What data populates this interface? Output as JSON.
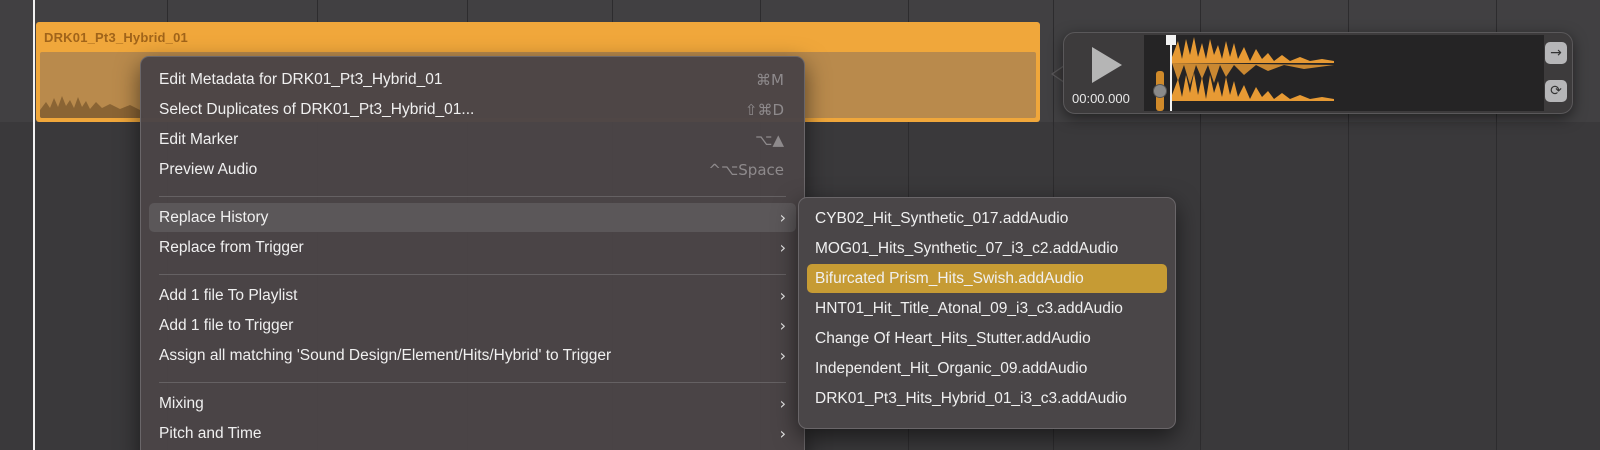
{
  "clip": {
    "title": "DRK01_Pt3_Hybrid_01",
    "color": "#f0a73b"
  },
  "preview": {
    "time": "00:00.000",
    "play_icon": "play-icon",
    "goto_icon": "arrow-right-icon",
    "loop_icon": "loop-icon",
    "goto_glyph": "→",
    "loop_glyph": "⟳"
  },
  "context_menu": {
    "items": [
      {
        "label": "Edit Metadata for DRK01_Pt3_Hybrid_01",
        "shortcut": "⌘M"
      },
      {
        "label": "Select Duplicates of DRK01_Pt3_Hybrid_01...",
        "shortcut": "⇧⌘D"
      },
      {
        "label": "Edit Marker",
        "shortcut": "⌥▲"
      },
      {
        "label": "Preview Audio",
        "shortcut": "^⌥Space"
      },
      {
        "label": "Replace History",
        "submenu": true
      },
      {
        "label": "Replace from Trigger",
        "submenu": true
      },
      {
        "label": "Add 1 file To Playlist",
        "submenu": true
      },
      {
        "label": "Add 1 file to Trigger",
        "submenu": true
      },
      {
        "label": "Assign all matching 'Sound Design/Element/Hits/Hybrid' to Trigger",
        "submenu": true
      },
      {
        "label": "Mixing",
        "submenu": true
      },
      {
        "label": "Pitch and Time",
        "submenu": true
      }
    ],
    "chevron": "›"
  },
  "submenu": {
    "items": [
      "CYB02_Hit_Synthetic_017.addAudio",
      "MOG01_Hits_Synthetic_07_i3_c2.addAudio",
      "Bifurcated Prism_Hits_Swish.addAudio",
      "HNT01_Hit_Title_Atonal_09_i3_c3.addAudio",
      "Change Of Heart_Hits_Stutter.addAudio",
      "Independent_Hit_Organic_09.addAudio",
      "DRK01_Pt3_Hits_Hybrid_01_i3_c3.addAudio"
    ],
    "selected_index": 2,
    "selected_color": "#c69b34"
  }
}
